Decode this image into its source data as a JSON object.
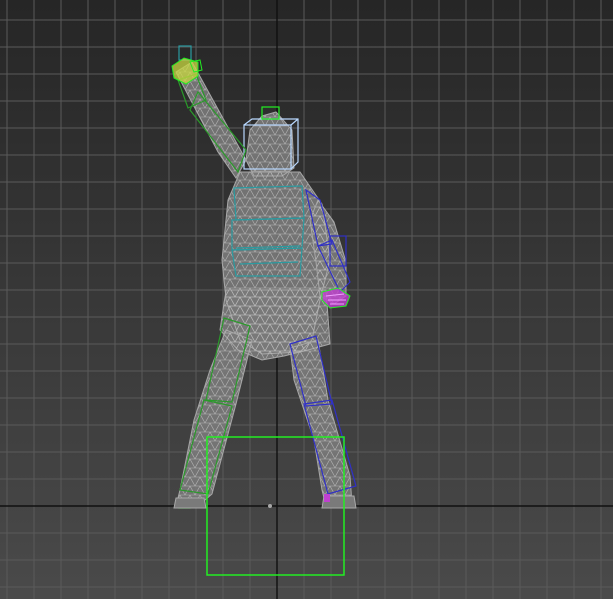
{
  "viewport": {
    "view": "front",
    "shading": "wireframe",
    "grid": true,
    "colors": {
      "background_top": "#262626",
      "background_bottom": "#4a4a4a",
      "grid_line": "#5a5a5a",
      "world_axis": "#101010",
      "mesh": "#a8a8a8",
      "mesh_fill": "#7a7a7a",
      "selection": "#22ee22",
      "biped_right": "#2a9a2a",
      "biped_left": "#3030c8",
      "spine": "#2a9aa0",
      "head": "#b8d8ff",
      "hand_right": "#c8d840",
      "hand_left": "#c040d0"
    }
  },
  "scene": {
    "objects": [
      {
        "name": "character-mesh",
        "type": "editable-mesh"
      },
      {
        "name": "biped-head",
        "type": "bone",
        "color": "head"
      },
      {
        "name": "biped-spine",
        "type": "bone",
        "color": "spine"
      },
      {
        "name": "biped-right-arm",
        "type": "bone",
        "color": "biped_right"
      },
      {
        "name": "biped-left-arm",
        "type": "bone",
        "color": "biped_left"
      },
      {
        "name": "biped-right-leg",
        "type": "bone",
        "color": "biped_right"
      },
      {
        "name": "biped-left-leg",
        "type": "bone",
        "color": "biped_left"
      },
      {
        "name": "biped-root-com",
        "type": "center-of-mass",
        "color": "selection"
      }
    ]
  }
}
